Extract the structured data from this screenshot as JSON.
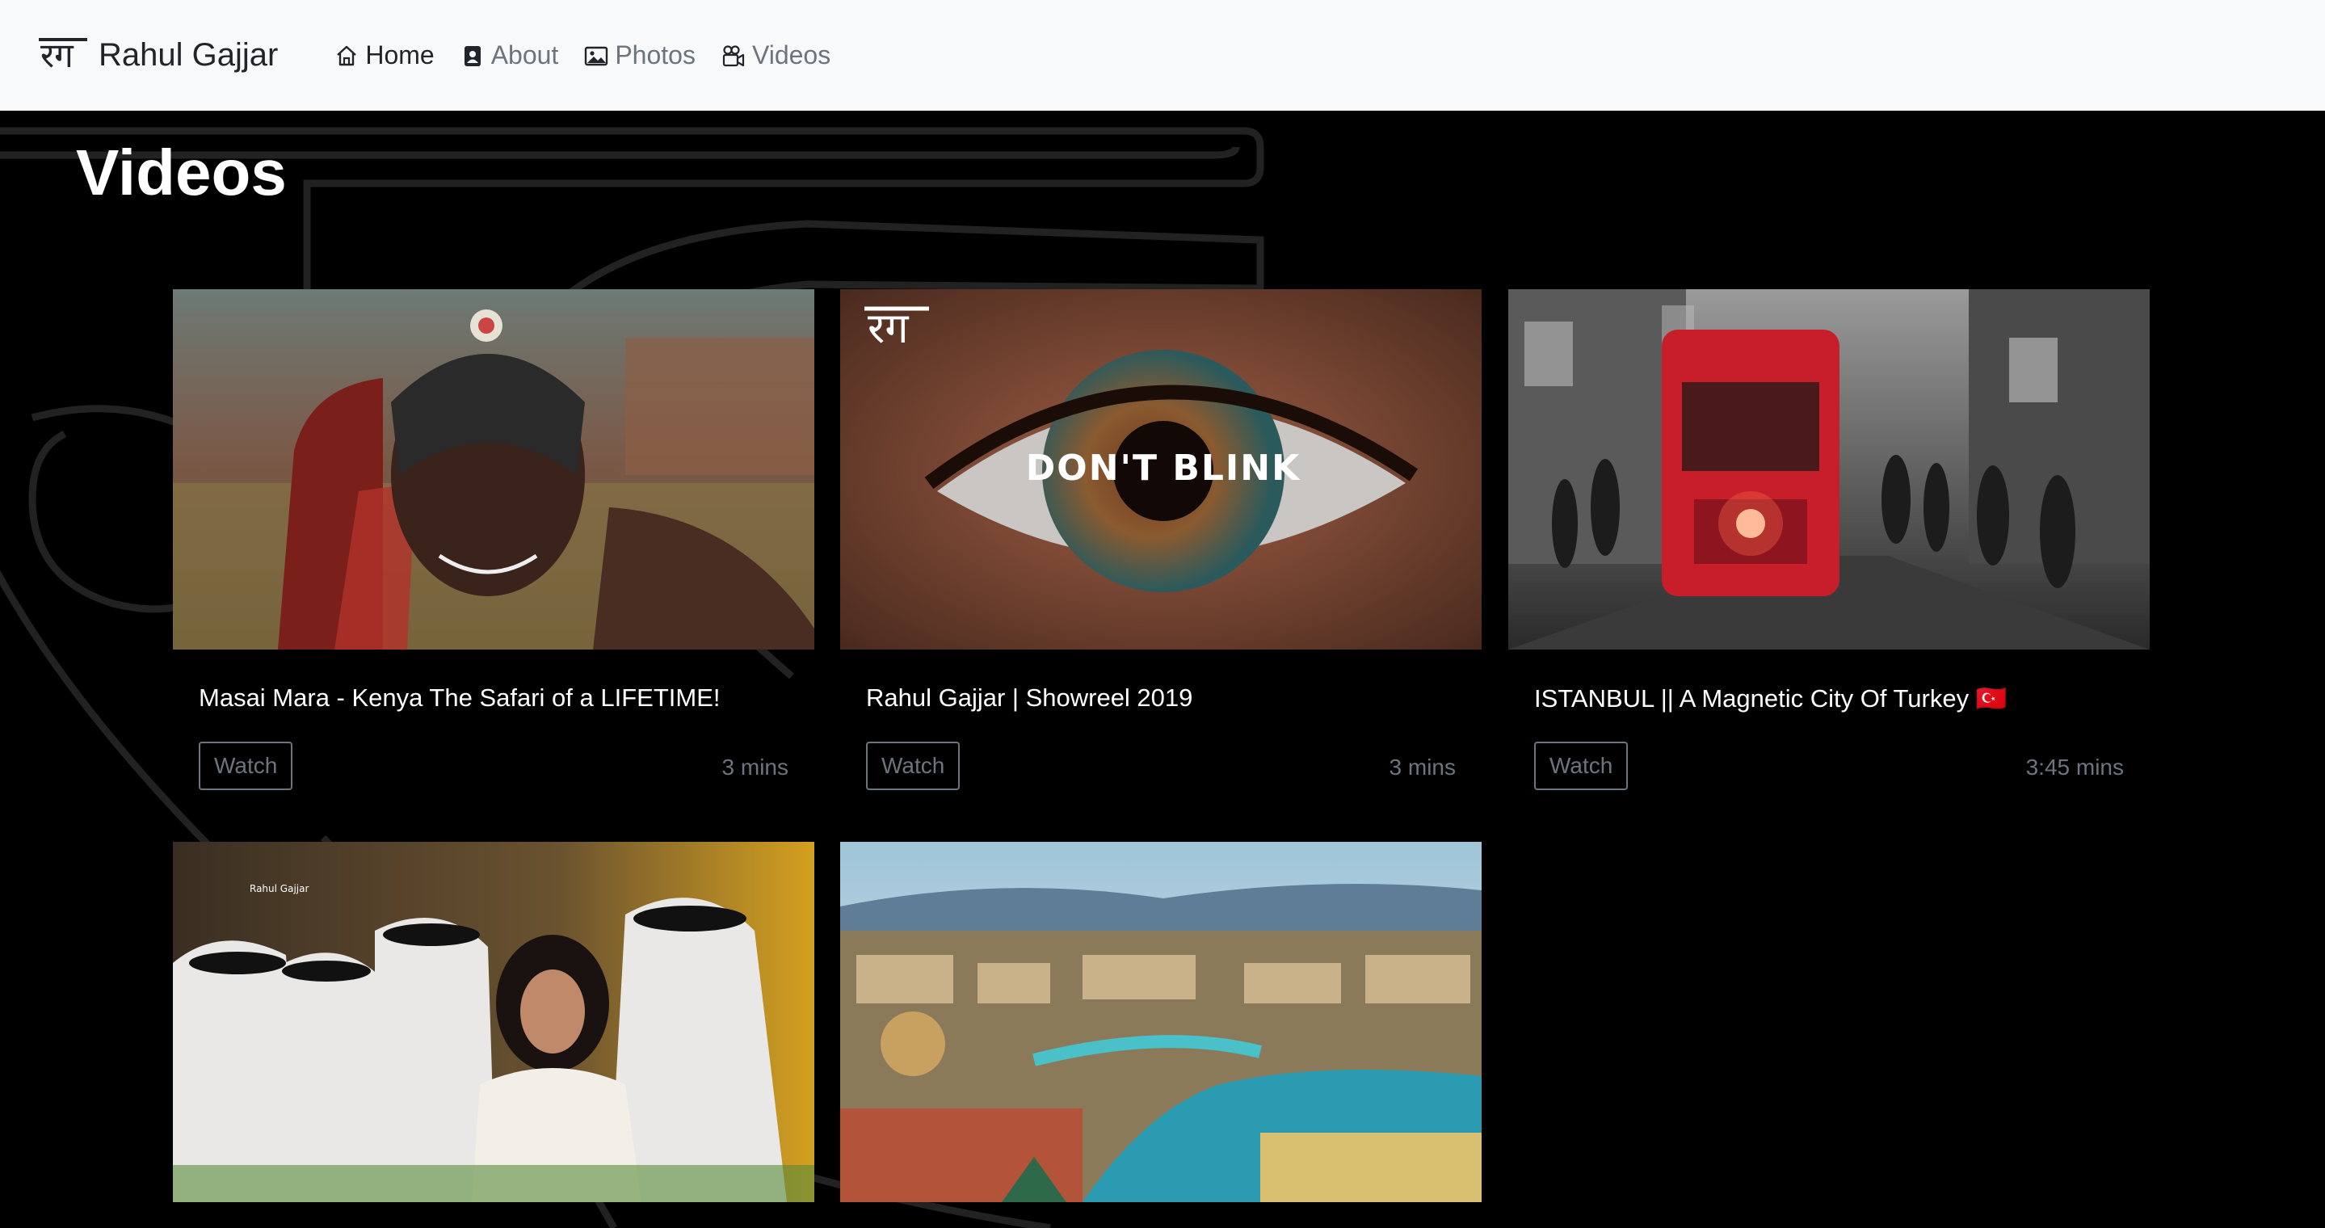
{
  "brand": {
    "logo_text": "रग",
    "name": "Rahul Gajjar"
  },
  "nav": [
    {
      "label": "Home",
      "icon": "house-icon",
      "active": true
    },
    {
      "label": "About",
      "icon": "person-badge-icon",
      "active": false
    },
    {
      "label": "Photos",
      "icon": "image-icon",
      "active": false
    },
    {
      "label": "Videos",
      "icon": "camera-reels-icon",
      "active": false
    }
  ],
  "page": {
    "title": "Videos"
  },
  "videos": [
    {
      "title": "Masai Mara - Kenya The Safari of a LIFETIME!",
      "button": "Watch",
      "duration": "3 mins"
    },
    {
      "title": "Rahul Gajjar | Showreel 2019",
      "button": "Watch",
      "duration": "3 mins",
      "thumb_text": "DON'T BLINK",
      "thumb_logo": "रग"
    },
    {
      "title": "ISTANBUL || A Magnetic City Of Turkey 🇹🇷",
      "button": "Watch",
      "duration": "3:45 mins"
    },
    {
      "title": "",
      "button": "",
      "duration": "",
      "thumb_text": "Rahul Gajjar"
    },
    {
      "title": "",
      "button": "",
      "duration": ""
    }
  ],
  "colors": {
    "navbar_bg": "#f8f9fa",
    "page_bg": "#000000",
    "muted": "#6c757d"
  }
}
